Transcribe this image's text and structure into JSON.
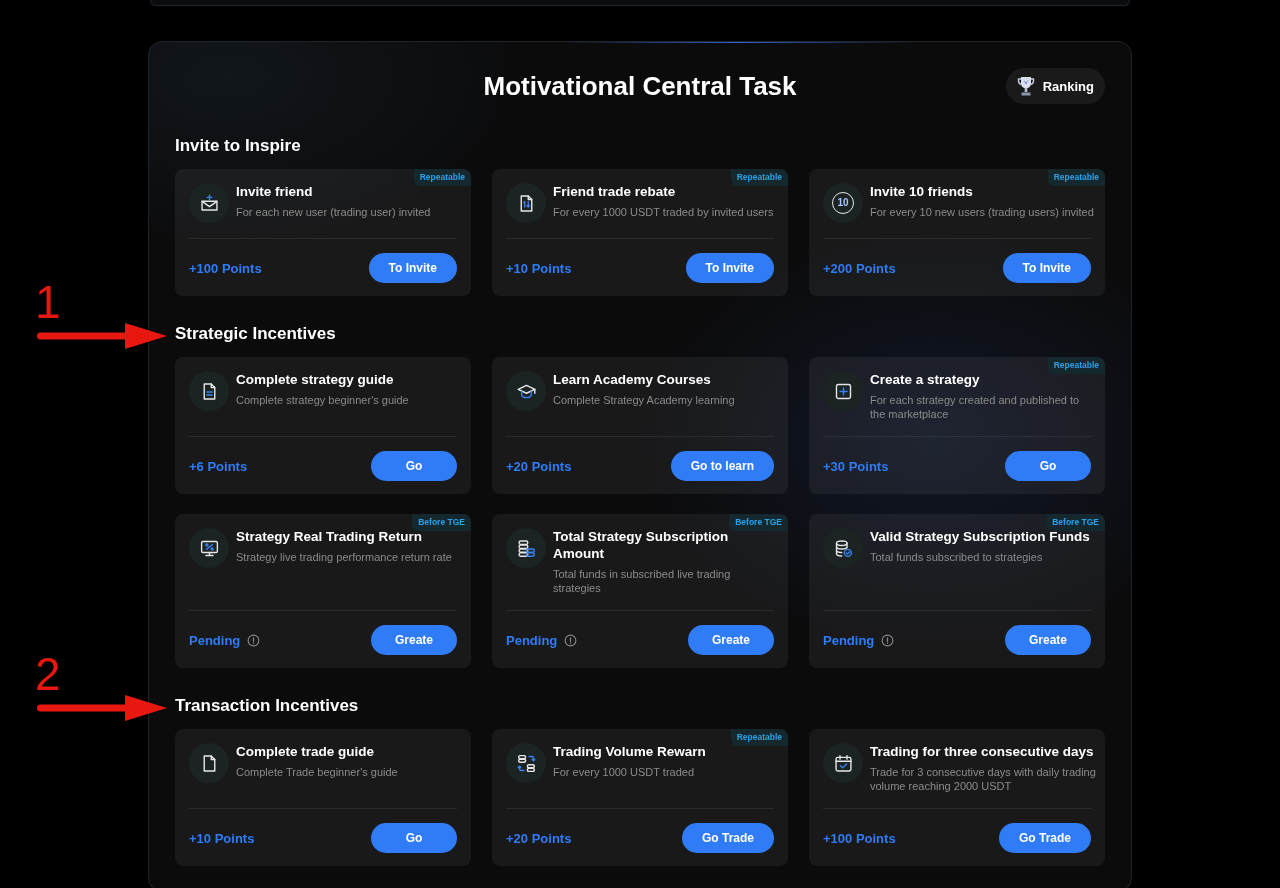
{
  "title": "Motivational Central Task",
  "ranking_button": {
    "label": "Ranking"
  },
  "sections": [
    {
      "heading": "Invite to Inspire",
      "tasks": [
        {
          "title": "Invite friend",
          "description": "For each new user (trading user) invited",
          "tag": "Repeatable",
          "reward": {
            "kind": "points",
            "text": "+100 Points"
          },
          "button": "To Invite"
        },
        {
          "title": "Friend trade rebate",
          "description": "For every 1000 USDT traded by invited users",
          "tag": "Repeatable",
          "reward": {
            "kind": "points",
            "text": "+10 Points"
          },
          "button": "To Invite"
        },
        {
          "title": "Invite 10 friends",
          "icon_label": "10",
          "description": "For every 10 new users (trading users) invited",
          "tag": "Repeatable",
          "reward": {
            "kind": "points",
            "text": "+200 Points"
          },
          "button": "To Invite"
        }
      ]
    },
    {
      "heading": "Strategic Incentives",
      "marker": "1",
      "tasks": [
        {
          "title": "Complete strategy guide",
          "description": "Complete strategy beginner's guide",
          "reward": {
            "kind": "points",
            "text": "+6 Points"
          },
          "button": "Go"
        },
        {
          "title": "Learn Academy Courses",
          "description": "Complete Strategy Academy learning",
          "reward": {
            "kind": "points",
            "text": "+20 Points"
          },
          "button": "Go to learn"
        },
        {
          "title": "Create a strategy",
          "description": "For each strategy created and published to the marketplace",
          "tag": "Repeatable",
          "reward": {
            "kind": "points",
            "text": "+30 Points"
          },
          "button": "Go"
        },
        {
          "title": "Strategy Real Trading Return",
          "description": "Strategy live trading performance return rate",
          "tag": "Before TGE",
          "reward": {
            "kind": "pending",
            "text": "Pending"
          },
          "button": "Greate"
        },
        {
          "title": "Total Strategy Subscription Amount",
          "description": "Total funds in subscribed live trading strategies",
          "tag": "Before TGE",
          "reward": {
            "kind": "pending",
            "text": "Pending"
          },
          "button": "Greate"
        },
        {
          "title": "Valid Strategy Subscription Funds",
          "description": "Total funds subscribed to strategies",
          "tag": "Before TGE",
          "reward": {
            "kind": "pending",
            "text": "Pending"
          },
          "button": "Greate"
        }
      ]
    },
    {
      "heading": "Transaction Incentives",
      "marker": "2",
      "tasks": [
        {
          "title": "Complete trade guide",
          "description": "Complete Trade beginner's guide",
          "reward": {
            "kind": "points",
            "text": "+10 Points"
          },
          "button": "Go"
        },
        {
          "title": "Trading Volume Rewarn",
          "description": "For every 1000 USDT traded",
          "tag": "Repeatable",
          "reward": {
            "kind": "points",
            "text": "+20 Points"
          },
          "button": "Go Trade"
        },
        {
          "title": "Trading for three consecutive days",
          "description": "Trade for 3 consecutive days with daily trading volume reaching 2000 USDT",
          "reward": {
            "kind": "points",
            "text": "+100 Points"
          },
          "button": "Go Trade"
        }
      ]
    }
  ]
}
